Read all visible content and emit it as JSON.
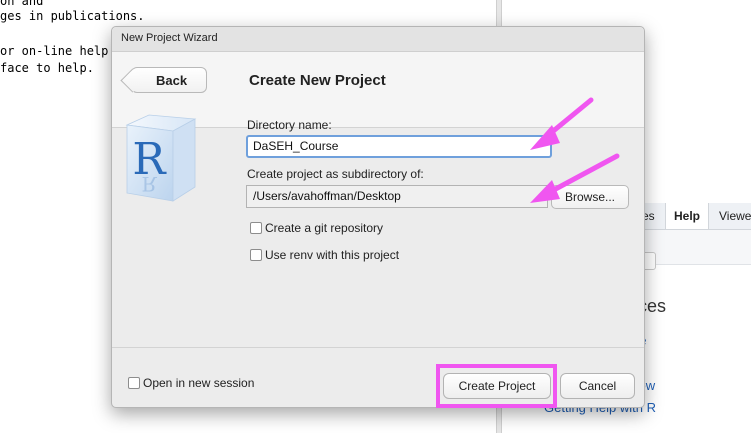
{
  "console": {
    "lines": [
      "on and",
      "ges in publications.",
      "",
      "or on-line help.",
      "face to help."
    ]
  },
  "right_pane": {
    "tabs": [
      "es",
      "Help",
      "Viewe"
    ],
    "heading": "rces",
    "links": [
      "ne",
      "vs",
      "flow",
      "Getting Help with R"
    ]
  },
  "dialog": {
    "window_title": "New Project Wizard",
    "back_label": "Back",
    "heading": "Create New Project",
    "directory_name_label": "Directory name:",
    "directory_name_value": "DaSEH_Course",
    "subdirectory_label": "Create project as subdirectory of:",
    "subdirectory_value": "/Users/avahoffman/Desktop",
    "browse_label": "Browse...",
    "git_repo_label": "Create a git repository",
    "git_repo_checked": false,
    "renv_label": "Use renv with this project",
    "renv_checked": false,
    "open_new_session_label": "Open in new session",
    "open_new_session_checked": false,
    "create_project_label": "Create Project",
    "cancel_label": "Cancel"
  },
  "annotations": {
    "arrow_color": "#f056f0",
    "highlight_color": "#f056f0"
  },
  "logo": {
    "letter": "R",
    "color": "#2a6ab8"
  }
}
